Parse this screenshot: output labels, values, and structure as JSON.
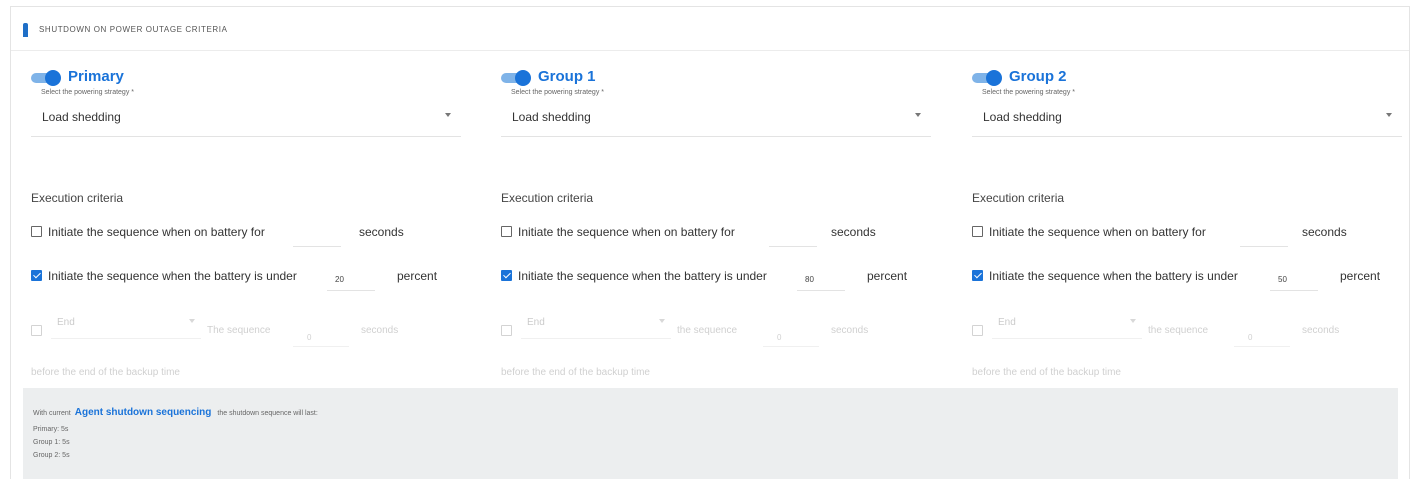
{
  "header": {
    "title": "SHUTDOWN ON POWER OUTAGE CRITERIA"
  },
  "colors": {
    "accent": "#1a73d9",
    "info_bg": "#eceeef"
  },
  "groups": [
    {
      "name": "Primary",
      "enabled": true,
      "strategy_label": "Select the powering strategy *",
      "strategy_value": "Load shedding",
      "criteria_title": "Execution criteria",
      "battery_time_text": "Initiate the sequence when on battery for",
      "battery_time_value": "",
      "battery_time_unit": "seconds",
      "battery_level_text": "Initiate the sequence when the battery is under",
      "battery_level_value": "20",
      "battery_level_unit": "percent",
      "end_select": "End",
      "sequence_text": "The sequence",
      "sequence_value": "0",
      "sequence_unit": "seconds",
      "footer_text": "before the end of the backup time"
    },
    {
      "name": "Group 1",
      "enabled": true,
      "strategy_label": "Select the powering strategy *",
      "strategy_value": "Load shedding",
      "criteria_title": "Execution criteria",
      "battery_time_text": "Initiate the sequence when on battery for",
      "battery_time_value": "",
      "battery_time_unit": "seconds",
      "battery_level_text": "Initiate the sequence when the battery is under",
      "battery_level_value": "80",
      "battery_level_unit": "percent",
      "end_select": "End",
      "sequence_text": "the sequence",
      "sequence_value": "0",
      "sequence_unit": "seconds",
      "footer_text": "before the end of the backup time"
    },
    {
      "name": "Group 2",
      "enabled": true,
      "strategy_label": "Select the powering strategy *",
      "strategy_value": "Load shedding",
      "criteria_title": "Execution criteria",
      "battery_time_text": "Initiate the sequence when on battery for",
      "battery_time_value": "",
      "battery_time_unit": "seconds",
      "battery_level_text": "Initiate the sequence when the battery is under",
      "battery_level_value": "50",
      "battery_level_unit": "percent",
      "end_select": "End",
      "sequence_text": "the sequence",
      "sequence_value": "0",
      "sequence_unit": "seconds",
      "footer_text": "before the end of the backup time"
    }
  ],
  "info": {
    "prefix": "With current",
    "link": "Agent shutdown sequencing",
    "suffix": "the shutdown sequence will last:",
    "items": [
      "Primary: 5s",
      "Group 1: 5s",
      "Group 2: 5s"
    ]
  }
}
